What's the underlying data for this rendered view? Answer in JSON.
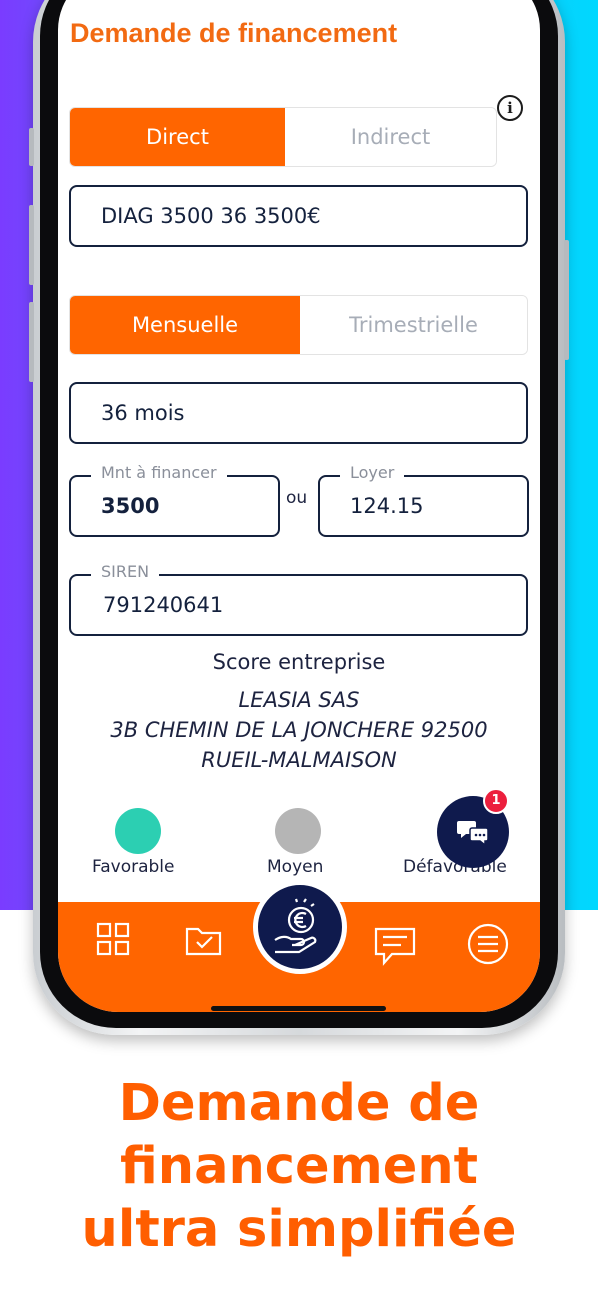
{
  "screen": {
    "title": "Demande de financement",
    "type_toggle": {
      "direct": "Direct",
      "indirect": "Indirect",
      "selected": "Direct"
    },
    "product_value": "DIAG 3500 36 3500€",
    "frequency_toggle": {
      "monthly": "Mensuelle",
      "quarterly": "Trimestrielle",
      "selected": "Mensuelle"
    },
    "duration_value": "36 mois",
    "amount": {
      "label": "Mnt à financer",
      "value": "3500"
    },
    "or_label": "ou",
    "rent": {
      "label": "Loyer",
      "value": "124.15"
    },
    "siren": {
      "label": "SIREN",
      "value": "791240641"
    },
    "score_title": "Score entreprise",
    "company": {
      "name": "LEASIA SAS",
      "address_line1": "3B CHEMIN DE LA JONCHERE 92500",
      "address_line2": "RUEIL-MALMAISON"
    },
    "ratings": [
      {
        "label": "Favorable",
        "color": "#2ccfb2"
      },
      {
        "label": "Moyen",
        "color": "#b5b5b5"
      },
      {
        "label": "Défavorable",
        "color": "#ffffff"
      }
    ],
    "chat_badge_count": "1",
    "nav": {
      "items": [
        "dashboard-icon",
        "folder-check-icon",
        "euro-hand-icon",
        "message-icon",
        "menu-icon"
      ]
    }
  },
  "tagline": {
    "line1": "Demande de",
    "line2": "financement",
    "line3": "ultra simplifiée"
  },
  "colors": {
    "accent": "#ff6500",
    "navy": "#14213d",
    "title": "#f26a12"
  }
}
